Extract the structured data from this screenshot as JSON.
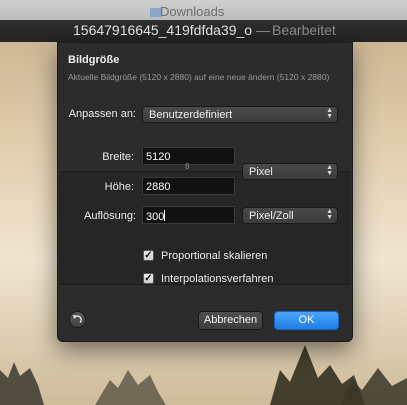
{
  "finder": {
    "folder_label": "Downloads",
    "folder_icon": "folder-icon"
  },
  "window": {
    "file_name": "15647916645_419fdfda39_o",
    "separator": "—",
    "state": "Bearbeitet"
  },
  "dialog": {
    "title": "Bildgröße",
    "subtitle": "Aktuelle Bildgröße (5120 x 2880) auf eine neue ändern (5120 x 2880)",
    "fit_label": "Anpassen an:",
    "fit_value": "Benutzerdefiniert",
    "width_label": "Breite:",
    "width_value": "5120",
    "height_label": "Höhe:",
    "height_value": "2880",
    "unit_value": "Pixel",
    "resolution_label": "Auflösung:",
    "resolution_value": "300",
    "resolution_unit": "Pixel/Zoll",
    "proportional_label": "Proportional skalieren",
    "proportional_checked": true,
    "interpolation_label": "Interpolationsverfahren",
    "interpolation_checked": true,
    "check_glyph": "✓",
    "cancel_label": "Abbrechen",
    "ok_label": "OK",
    "revert_icon": "revert-icon",
    "accent_color": "#1d7fe8"
  }
}
